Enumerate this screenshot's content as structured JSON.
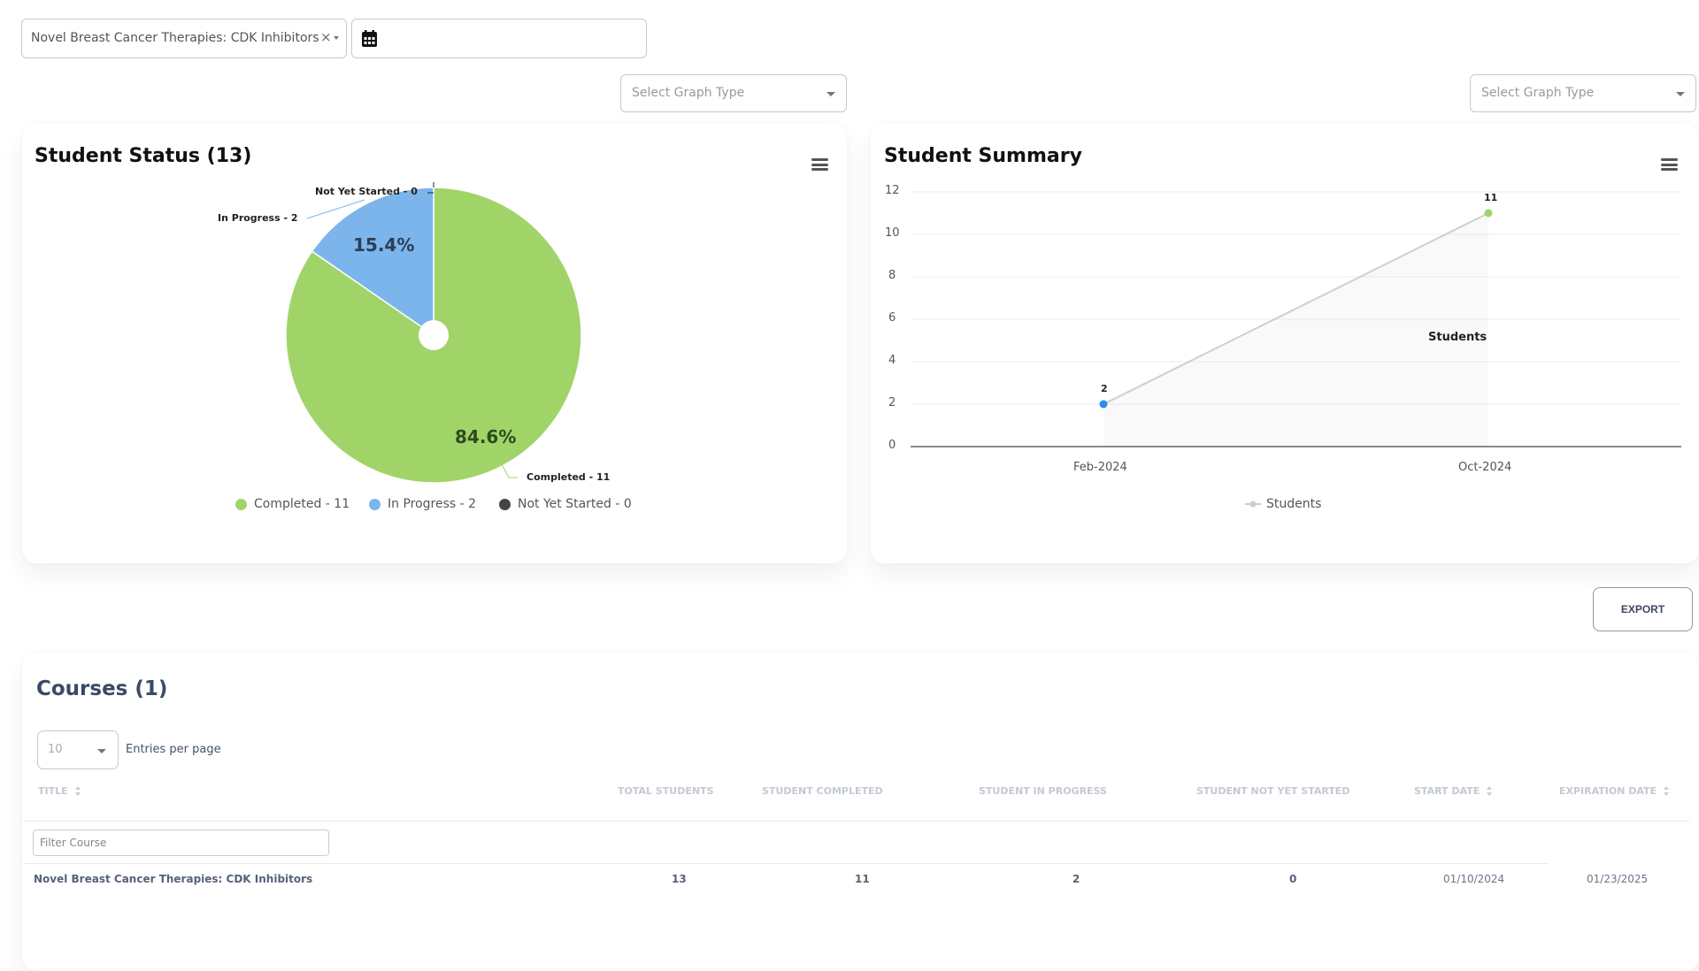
{
  "filters": {
    "course_select_value": "Novel Breast Cancer Therapies: CDK Inhibitors",
    "clear_icon": "×",
    "date_placeholder": ""
  },
  "graph_type_selects": [
    {
      "placeholder": "Select Graph Type"
    },
    {
      "placeholder": "Select Graph Type"
    }
  ],
  "student_status": {
    "title": "Student Status (13)",
    "labels": {
      "not_yet_started": "Not Yet Started - 0",
      "in_progress": "In Progress - 2",
      "completed": "Completed - 11"
    },
    "percents": {
      "in_progress": "15.4%",
      "completed": "84.6%"
    },
    "legend": [
      {
        "label": "Completed - 11",
        "color": "#a0d468"
      },
      {
        "label": "In Progress - 2",
        "color": "#7cb5ec"
      },
      {
        "label": "Not Yet Started - 0",
        "color": "#434348"
      }
    ]
  },
  "student_summary": {
    "title": "Student Summary",
    "series_label": "Students",
    "legend_label": "Students",
    "data_labels": [
      "2",
      "11"
    ]
  },
  "chart_data": [
    {
      "type": "pie",
      "title": "Student Status (13)",
      "categories": [
        "Completed",
        "In Progress",
        "Not Yet Started"
      ],
      "values": [
        11,
        2,
        0
      ],
      "percentages": [
        84.6,
        15.4,
        0
      ],
      "colors": [
        "#a0d468",
        "#7cb5ec",
        "#434348"
      ],
      "legend": "bottom"
    },
    {
      "type": "line",
      "title": "Student Summary",
      "categories": [
        "Feb-2024",
        "Oct-2024"
      ],
      "series": [
        {
          "name": "Students",
          "values": [
            2,
            11
          ],
          "point_colors": [
            "#2f8cf0",
            "#a0d468"
          ]
        }
      ],
      "yticks": [
        "0",
        "2",
        "4",
        "6",
        "8",
        "10",
        "12"
      ],
      "ylim": [
        0,
        12
      ],
      "grid": true,
      "legend": "bottom"
    }
  ],
  "export_label": "EXPORT",
  "courses": {
    "title": "Courses (1)",
    "entries_value": "10",
    "entries_label": "Entries per page",
    "filter_placeholder": "Filter Course",
    "columns": [
      "TITLE",
      "TOTAL STUDENTS",
      "STUDENT COMPLETED",
      "STUDENT IN PROGRESS",
      "STUDENT NOT YET STARTED",
      "START DATE",
      "EXPIRATION DATE"
    ],
    "rows": [
      [
        "Novel Breast Cancer Therapies: CDK Inhibitors",
        "13",
        "11",
        "2",
        "0",
        "01/10/2024",
        "01/23/2025"
      ]
    ]
  }
}
